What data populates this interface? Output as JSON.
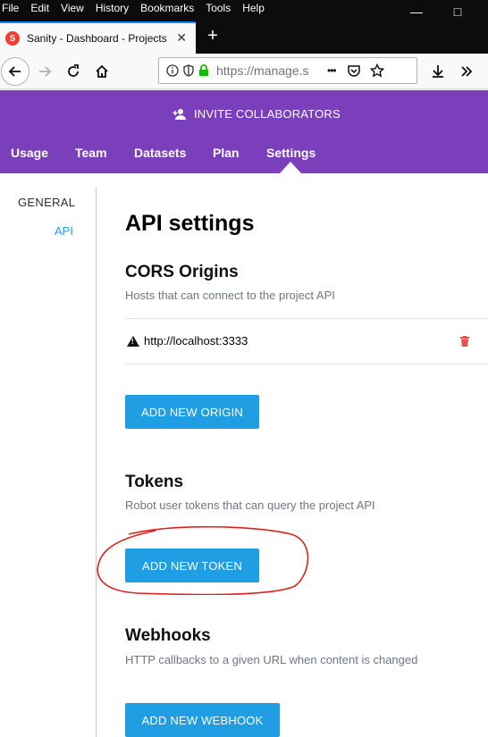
{
  "menubar": {
    "items": [
      {
        "first": "F",
        "rest": "ile"
      },
      {
        "first": "E",
        "rest": "dit"
      },
      {
        "first": "V",
        "rest": "iew"
      },
      {
        "first": "",
        "rest": "History",
        "u": "s"
      },
      {
        "first": "B",
        "rest": "ookmarks"
      },
      {
        "first": "T",
        "rest": "ools"
      },
      {
        "first": "H",
        "rest": "elp"
      }
    ],
    "labels": [
      "File",
      "Edit",
      "View",
      "History",
      "Bookmarks",
      "Tools",
      "Help"
    ]
  },
  "window": {
    "minimize": "—",
    "maximize": "□"
  },
  "tab": {
    "favicon": "S",
    "title": "Sanity - Dashboard - Projects",
    "close": "✕",
    "new_tab": "+"
  },
  "urlbar": {
    "url": "https://manage.s",
    "more": "•••"
  },
  "header": {
    "invite_label": "INVITE COLLABORATORS",
    "tabs": [
      "Usage",
      "Team",
      "Datasets",
      "Plan",
      "Settings"
    ],
    "active_tab": "Settings",
    "color": "#7b3fbb"
  },
  "sidenav": {
    "general": "GENERAL",
    "api": "API"
  },
  "main": {
    "title": "API settings",
    "cors": {
      "heading": "CORS Origins",
      "description": "Hosts that can connect to the project API",
      "origins": [
        "http://localhost:3333"
      ],
      "add_button": "ADD NEW ORIGIN"
    },
    "tokens": {
      "heading": "Tokens",
      "description": "Robot user tokens that can query the project API",
      "add_button": "ADD NEW TOKEN"
    },
    "webhooks": {
      "heading": "Webhooks",
      "description": "HTTP callbacks to a given URL when content is changed",
      "add_button": "ADD NEW WEBHOOK"
    }
  },
  "colors": {
    "accent": "#1f9ee3",
    "danger": "#e2534a",
    "annotation": "#e0201c"
  }
}
